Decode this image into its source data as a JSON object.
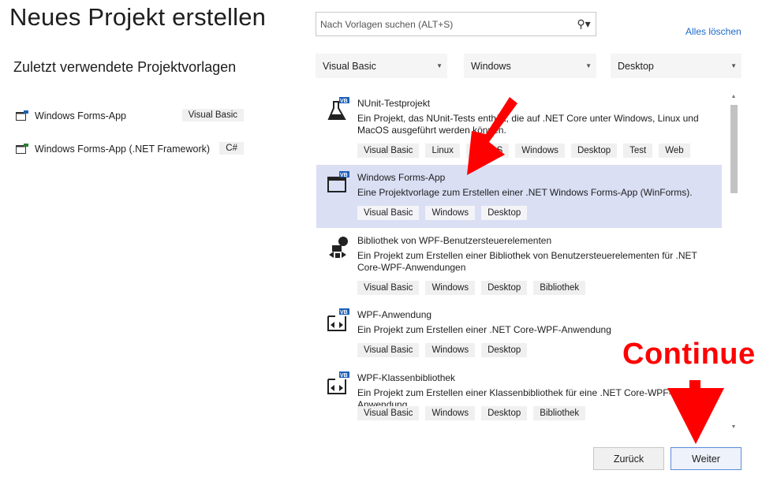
{
  "header": {
    "title": "Neues Projekt erstellen"
  },
  "recent": {
    "heading": "Zuletzt verwendete Projektvorlagen",
    "items": [
      {
        "label": "Windows Forms-App",
        "lang": "Visual Basic"
      },
      {
        "label": "Windows Forms-App (.NET Framework)",
        "lang": "C#"
      }
    ]
  },
  "search": {
    "placeholder": "Nach Vorlagen suchen (ALT+S)",
    "icon": "search-icon"
  },
  "clear_all": "Alles löschen",
  "filters": {
    "language": "Visual Basic",
    "platform": "Windows",
    "project_type": "Desktop"
  },
  "templates": [
    {
      "title": "NUnit-Testprojekt",
      "desc": "Ein Projekt, das NUnit-Tests enthält, die auf .NET Core unter Windows, Linux und MacOS ausgeführt werden können.",
      "tags": [
        "Visual Basic",
        "Linux",
        "macOS",
        "Windows",
        "Desktop",
        "Test",
        "Web"
      ],
      "icon": "flask-vb-icon"
    },
    {
      "title": "Windows Forms-App",
      "desc": "Eine Projektvorlage zum Erstellen einer .NET Windows Forms-App (WinForms).",
      "tags": [
        "Visual Basic",
        "Windows",
        "Desktop"
      ],
      "icon": "window-vb-icon",
      "selected": true
    },
    {
      "title": "Bibliothek von WPF-Benutzersteuerelementen",
      "desc": "Ein Projekt zum Erstellen einer Bibliothek von Benutzersteuerelementen für .NET Core-WPF-Anwendungen",
      "tags": [
        "Visual Basic",
        "Windows",
        "Desktop",
        "Bibliothek"
      ],
      "icon": "wpf-controls-icon"
    },
    {
      "title": "WPF-Anwendung",
      "desc": "Ein Projekt zum Erstellen einer .NET Core-WPF-Anwendung",
      "tags": [
        "Visual Basic",
        "Windows",
        "Desktop"
      ],
      "icon": "wpf-app-vb-icon"
    },
    {
      "title": "WPF-Klassenbibliothek",
      "desc": "Ein Projekt zum Erstellen einer Klassenbibliothek für eine .NET Core-WPF-Anwendung",
      "tags": [
        "Visual Basic",
        "Windows",
        "Desktop",
        "Bibliothek"
      ],
      "icon": "wpf-library-vb-icon"
    }
  ],
  "buttons": {
    "back": "Zurück",
    "next": "Weiter"
  },
  "annotation": {
    "text": "Continue",
    "color": "#ff0000"
  },
  "colors": {
    "selected_bg": "#dadff4",
    "link": "#1b6ac9",
    "vb_badge": "#1b5fb8"
  }
}
